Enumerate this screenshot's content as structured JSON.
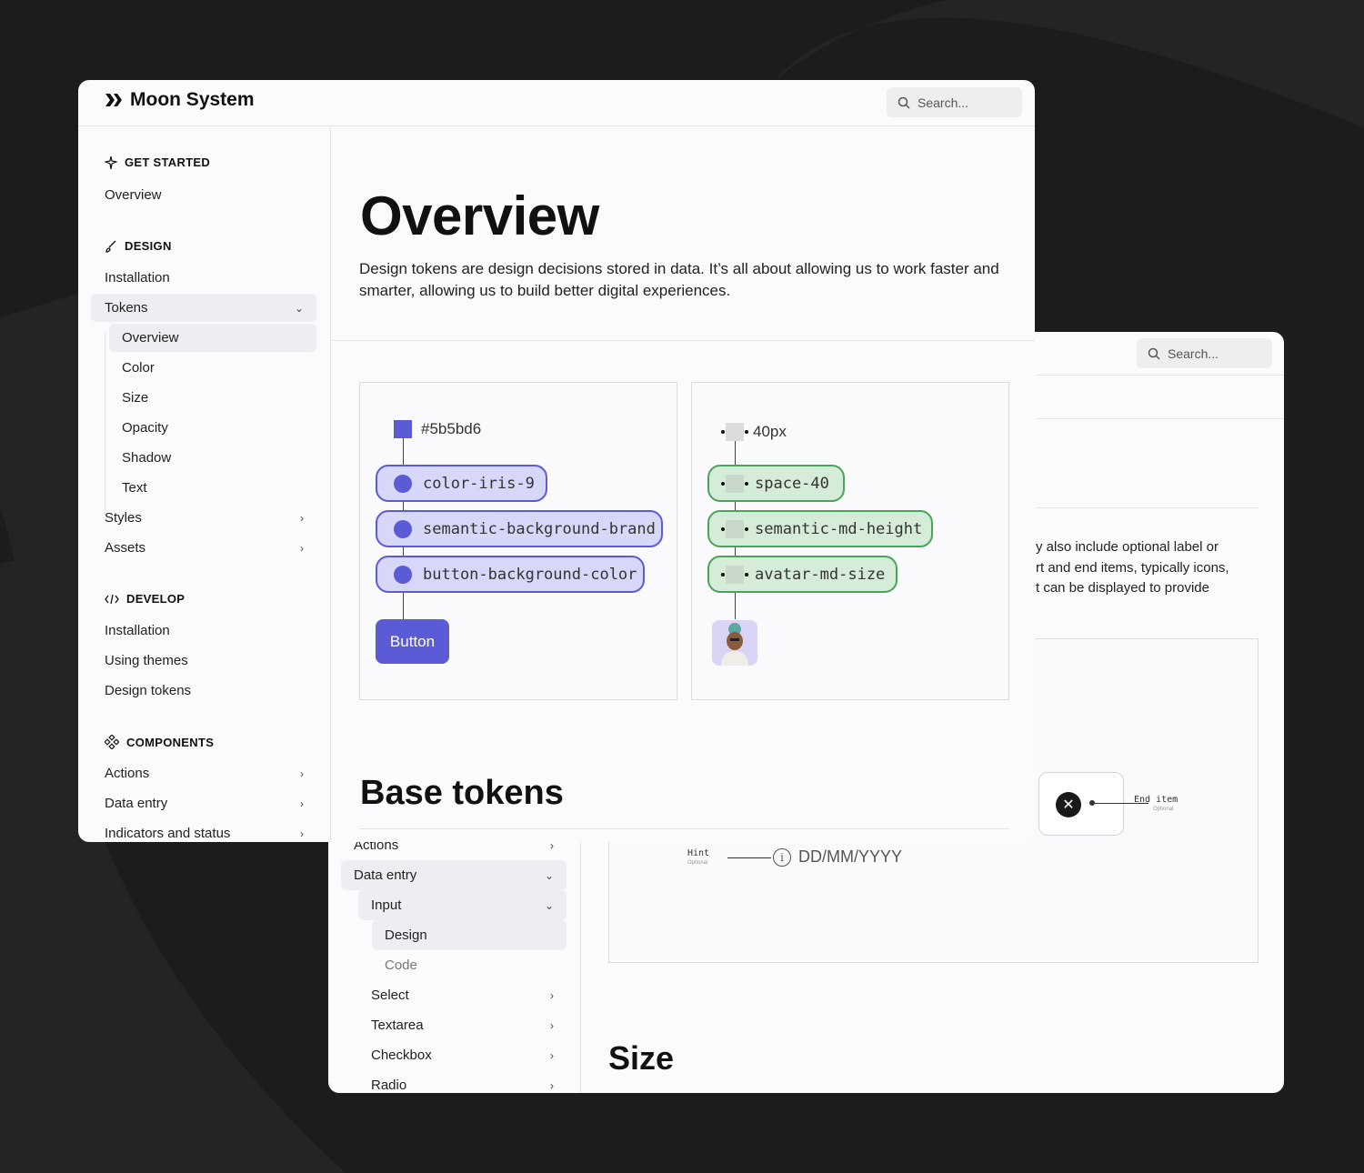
{
  "app": {
    "name": "Moon System"
  },
  "search": {
    "placeholder": "Search..."
  },
  "sidebar": {
    "sections": [
      {
        "title": "GET STARTED",
        "icon": "sparkle-icon"
      },
      {
        "title": "DESIGN",
        "icon": "brush-icon"
      },
      {
        "title": "DEVELOP",
        "icon": "code-icon"
      },
      {
        "title": "COMPONENTS",
        "icon": "components-icon"
      }
    ],
    "get_started": [
      "Overview"
    ],
    "design": {
      "installation": "Installation",
      "tokens": "Tokens",
      "tokens_children": [
        "Overview",
        "Color",
        "Size",
        "Opacity",
        "Shadow",
        "Text"
      ],
      "styles": "Styles",
      "assets": "Assets"
    },
    "develop": [
      "Installation",
      "Using themes",
      "Design tokens"
    ],
    "components": [
      "Actions",
      "Data entry",
      "Indicators and status"
    ]
  },
  "main": {
    "title": "Overview",
    "description": "Design tokens are design decisions stored in data. It’s all about allowing us to work faster and smarter, allowing us to build better digital experiences.",
    "color_diagram": {
      "hex": "#5b5bd6",
      "tokens": [
        "color-iris-9",
        "semantic-background-brand",
        "button-background-color"
      ],
      "button_label": "Button"
    },
    "size_diagram": {
      "value": "40px",
      "tokens": [
        "space-40",
        "semantic-md-height",
        "avatar-md-size"
      ]
    },
    "section_title": "Base tokens"
  },
  "back_window": {
    "text_lines": [
      "y also include optional label or",
      "rt and end items, typically icons,",
      "t can be displayed to provide"
    ],
    "end_item_label": "End item",
    "end_item_sub": "Optional",
    "hint_label": "Hint",
    "hint_sub": "Optional",
    "date_placeholder": "DD/MM/YYYY",
    "size_title": "Size",
    "nav": {
      "actions": "Actions",
      "data_entry": "Data entry",
      "input": "Input",
      "design": "Design",
      "code": "Code",
      "items": [
        "Select",
        "Textarea",
        "Checkbox",
        "Radio"
      ]
    }
  },
  "colors": {
    "iris": "#5b5bd6",
    "green": "#4aa35a",
    "background": "#1b1c1e"
  }
}
